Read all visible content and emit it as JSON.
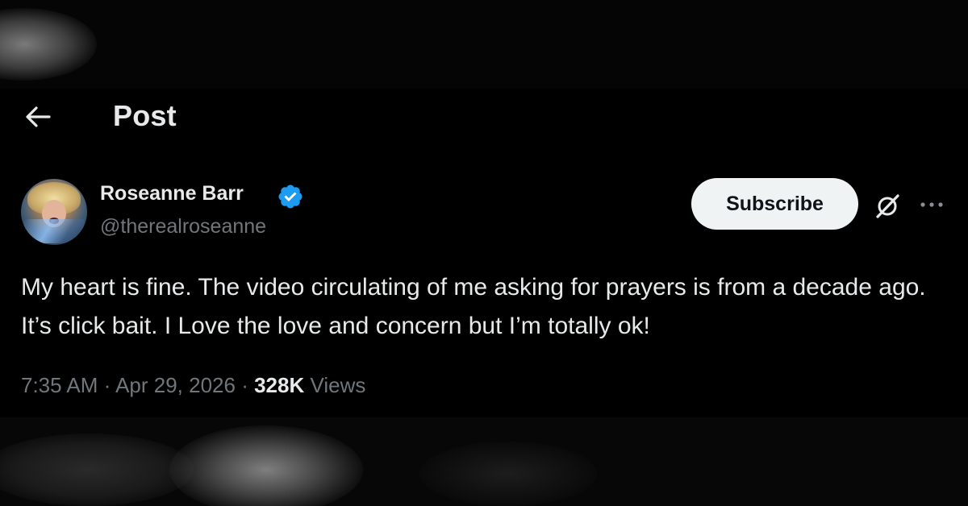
{
  "header": {
    "title": "Post",
    "back_icon": "arrow-left-icon"
  },
  "author": {
    "name": "Roseanne Barr",
    "handle": "@therealroseanne",
    "verified": true,
    "verified_color": "#1d9bf0"
  },
  "actions": {
    "subscribe_label": "Subscribe",
    "grok_icon": "grok-icon",
    "more_icon": "more-horizontal-icon"
  },
  "post": {
    "text": "My heart is fine. The video circulating of me asking for prayers is from a decade ago. It’s click bait. I Love the love and concern but I’m totally ok!",
    "time": "7:35 AM",
    "separator1": " · ",
    "date": "Apr 29, 2026",
    "separator2": " · ",
    "views_count": "328K",
    "views_label": " Views"
  },
  "colors": {
    "background": "#000000",
    "primary_text": "#e7e9ea",
    "secondary_text": "#71767b",
    "button_bg": "#eff3f4"
  }
}
